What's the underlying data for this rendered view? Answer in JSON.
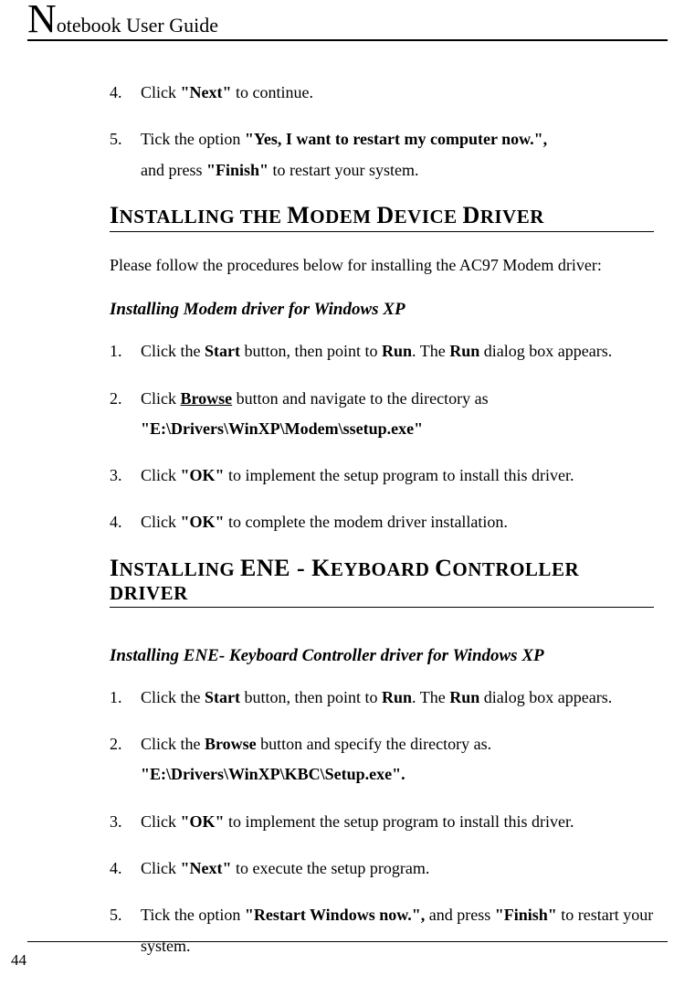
{
  "header": {
    "title_big": "N",
    "title_rest": "otebook User Guide"
  },
  "top_list": [
    {
      "num": "4.",
      "text_a": "Click ",
      "bold_a": "\"Next\"",
      "text_b": " to continue."
    },
    {
      "num": "5.",
      "text_a": "Tick the option ",
      "bold_a": "\"Yes, I want to restart my computer now.\",",
      "line2_a": "and press ",
      "bold_b": "\"Finish\"",
      "line2_b": " to restart your system."
    }
  ],
  "section1": {
    "heading": "Installing the Modem Device Driver",
    "intro": "Please follow the procedures below for installing the AC97 Modem driver:",
    "sub": "Installing Modem driver for Windows XP",
    "steps": [
      {
        "num": "1.",
        "t1": "Click the ",
        "b1": "Start",
        "t2": " button, then point to ",
        "b2": "Run",
        "t3": ". The ",
        "b3": "Run",
        "t4": " dialog box appears."
      },
      {
        "num": "2.",
        "t1": "Click ",
        "b1u": "Browse",
        "t2": " button and navigate to the directory as ",
        "b2line2": "\"E:\\Drivers\\WinXP\\Modem\\ssetup.exe\""
      },
      {
        "num": "3.",
        "t1": "Click ",
        "b1": "\"OK\"",
        "t2": " to implement the setup program to install this driver."
      },
      {
        "num": "4.",
        "t1": "Click ",
        "b1": "\"OK\"",
        "t2": " to complete the modem driver installation."
      }
    ]
  },
  "section2": {
    "heading": "Installing ENE - Keyboard Controller driver",
    "sub": "Installing ENE- Keyboard Controller driver for Windows XP",
    "steps": [
      {
        "num": "1.",
        "t1": "Click the ",
        "b1": "Start",
        "t2": " button, then point to ",
        "b2": "Run",
        "t3": ". The ",
        "b3": "Run",
        "t4": " dialog box appears."
      },
      {
        "num": "2.",
        "t1": "Click the ",
        "b1": "Browse",
        "t2": " button and specify the directory as.",
        "b2line2": "\"E:\\Drivers\\WinXP\\KBC\\Setup.exe\"."
      },
      {
        "num": "3.",
        "t1": "Click ",
        "b1": "\"OK\"",
        "t2": " to implement the setup program to install this driver."
      },
      {
        "num": "4.",
        "t1": "Click ",
        "b1": "\"Next\"",
        "t2": " to execute the setup program."
      },
      {
        "num": "5.",
        "t1": "Tick the option ",
        "b1": "\"Restart Windows now.\",",
        "t2": "  and press ",
        "b2": "\"Finish\"",
        "t3": " to restart your system."
      }
    ]
  },
  "page_number": "44"
}
